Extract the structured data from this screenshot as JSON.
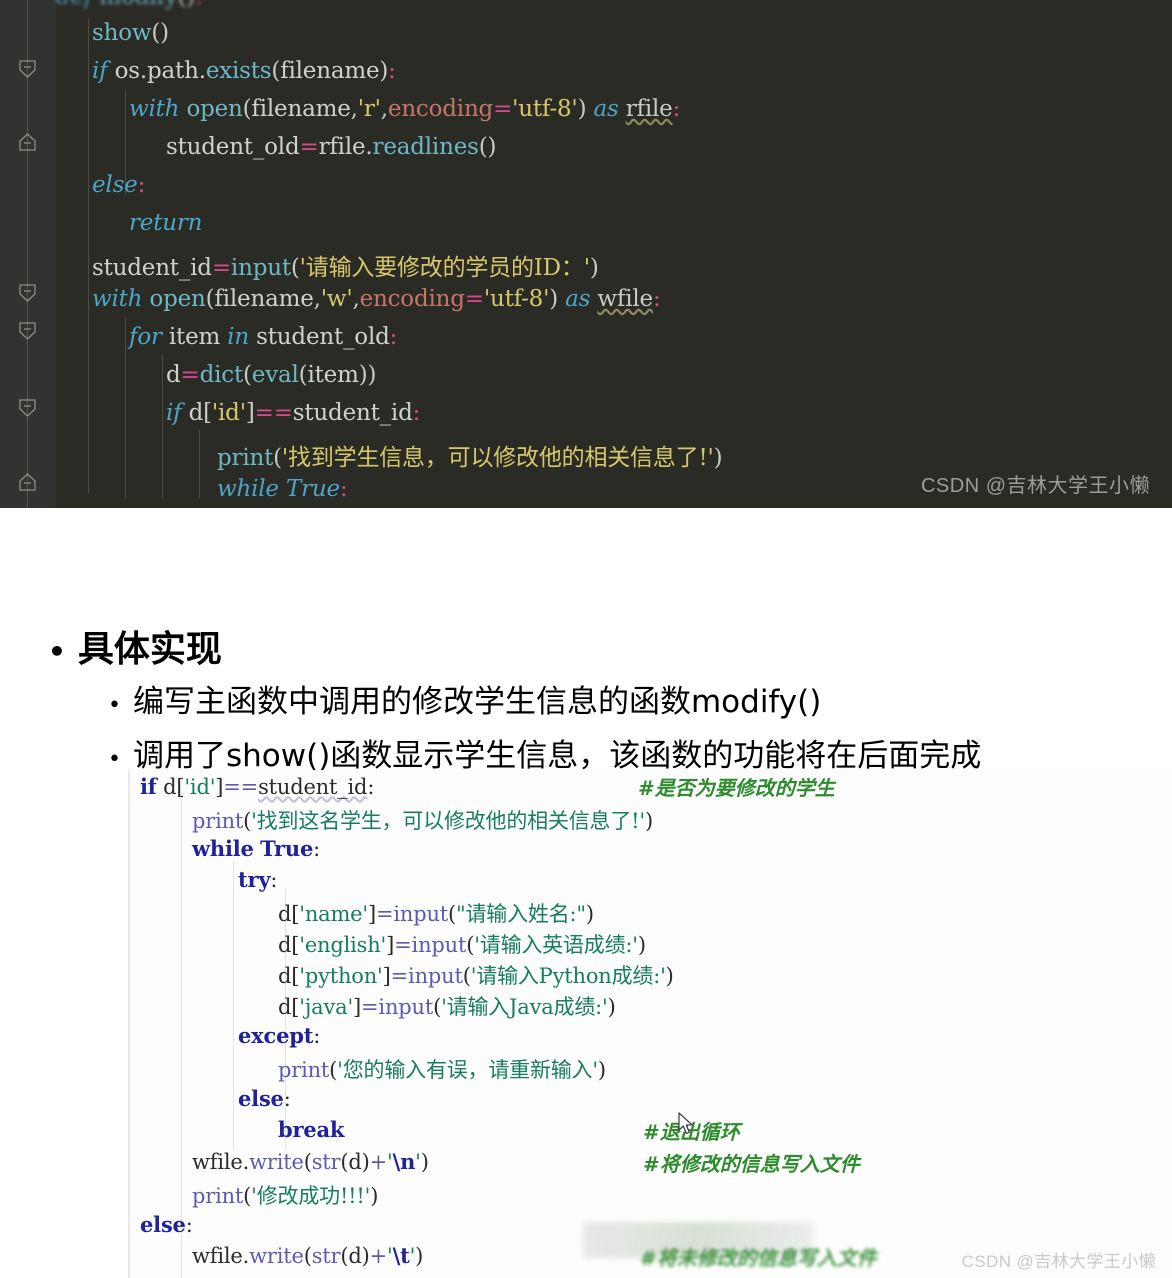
{
  "slide": {
    "heading": "具体实现",
    "heading_bullet": "•",
    "sub_bullets": [
      "编写主函数中调用的修改学生信息的函数modify()",
      "调用了show()函数显示学生信息，该函数的功能将在后面完成"
    ]
  },
  "watermark": {
    "top": "CSDN @吉林大学王小懒",
    "bottom": "CSDN @吉林大学王小懒"
  },
  "dark_editor": {
    "theme": "dark",
    "background": "#2b2b26",
    "gutter_background": "#313331",
    "language": "python",
    "fold_markers": 6,
    "lines": [
      "def modify():",
      "    show()",
      "    if os.path.exists(filename):",
      "        with open(filename,'r',encoding='utf-8') as rfile:",
      "            student_old=rfile.readlines()",
      "    else:",
      "        return",
      "    student_id=input('请输入要修改的学员的ID：')",
      "    with open(filename,'w',encoding='utf-8') as wfile:",
      "        for item in student_old:",
      "            d=dict(eval(item))",
      "            if d['id']==student_id:",
      "                print('找到学生信息，可以修改他的相关信息了!')",
      "                while True:"
    ]
  },
  "light_code": {
    "theme": "light",
    "background": "#fdfdfd",
    "language": "python",
    "lines": [
      "if d['id']==student_id:",
      "    print('找到这名学生，可以修改他的相关信息了!')",
      "    while True:",
      "        try:",
      "            d['name']=input(\"请输入姓名:\")",
      "            d['english']=input('请输入英语成绩:')",
      "            d['python']=input('请输入Python成绩:')",
      "            d['java']=input('请输入Java成绩:')",
      "        except:",
      "            print('您的输入有误，请重新输入')",
      "        else:",
      "            break",
      "    wfile.write(str(d)+'\\n')",
      "    print('修改成功!!!')",
      "else:",
      "    wfile.write(str(d)+'\\t')"
    ],
    "comments": [
      "#是否为要修改的学生",
      "#退出循环",
      "#将修改的信息写入文件",
      "#将未修改的信息写入文件"
    ],
    "comment_color": "#2e8b2e"
  }
}
